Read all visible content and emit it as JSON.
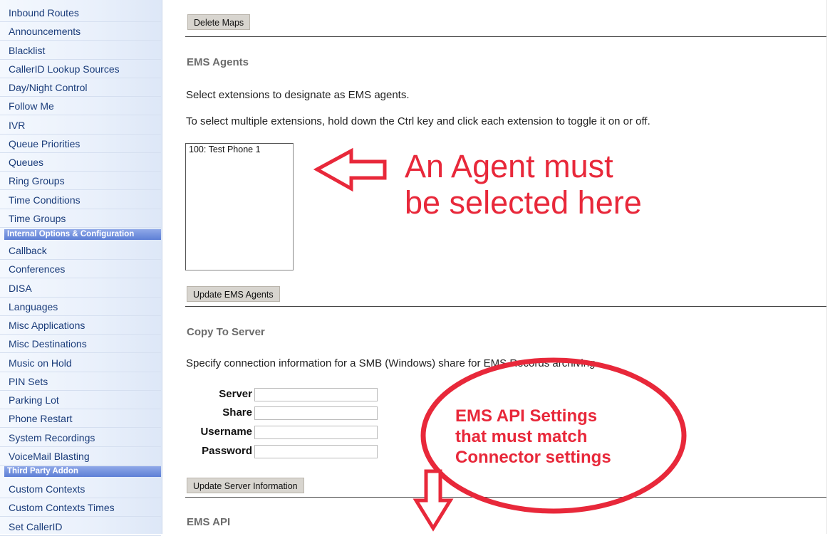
{
  "sidebar": {
    "items_top": [
      "Inbound Routes",
      "Announcements",
      "Blacklist",
      "CallerID Lookup Sources",
      "Day/Night Control",
      "Follow Me",
      "IVR",
      "Queue Priorities",
      "Queues",
      "Ring Groups",
      "Time Conditions",
      "Time Groups"
    ],
    "section_internal": "Internal Options & Configuration",
    "items_internal": [
      "Callback",
      "Conferences",
      "DISA",
      "Languages",
      "Misc Applications",
      "Misc Destinations",
      "Music on Hold",
      "PIN Sets",
      "Parking Lot",
      "Phone Restart",
      "System Recordings",
      "VoiceMail Blasting"
    ],
    "section_third": "Third Party Addon",
    "items_third": [
      "Custom Contexts",
      "Custom Contexts Times",
      "Set CallerID"
    ]
  },
  "main": {
    "delete_maps_button": "Delete Maps",
    "ems_agents": {
      "heading": "EMS Agents",
      "description": "Select extensions to designate as EMS agents.",
      "instruction": "To select multiple extensions, hold down the Ctrl key and click each extension to toggle it on or off.",
      "options": [
        "100: Test Phone 1"
      ],
      "update_button": "Update EMS Agents"
    },
    "copy_to_server": {
      "heading": "Copy To Server",
      "description": "Specify connection information for a SMB (Windows) share for EMS Records archiving.",
      "fields": [
        {
          "label": "Server",
          "value": ""
        },
        {
          "label": "Share",
          "value": ""
        },
        {
          "label": "Username",
          "value": ""
        },
        {
          "label": "Password",
          "value": ""
        }
      ],
      "update_button": "Update Server Information"
    },
    "ems_api": {
      "heading": "EMS API"
    }
  },
  "annotations": {
    "agent_note_line1": "An Agent must",
    "agent_note_line2": "be selected here",
    "api_note_line1": "EMS API Settings",
    "api_note_line2": "that must match",
    "api_note_line3": "Connector settings",
    "color": "#e8283a"
  }
}
